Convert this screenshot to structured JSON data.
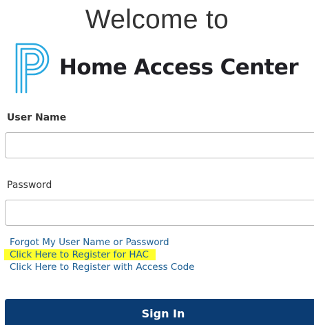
{
  "header": {
    "welcome_text": "Welcome to",
    "app_name": "Home Access Center",
    "logo_icon": "powerschool-p-logo-icon",
    "logo_color": "#2aa9e0"
  },
  "form": {
    "username_label": "User Name",
    "username_value": "",
    "password_label": "Password",
    "password_value": ""
  },
  "links": {
    "forgot": "Forgot My User Name or Password",
    "register_hac": "Click Here to Register for HAC",
    "register_access_code": "Click Here to Register with Access Code",
    "link_color": "#1d5f93",
    "highlight_color": "#ffff2e"
  },
  "actions": {
    "signin_label": "Sign In",
    "signin_color": "#0b3c73"
  }
}
